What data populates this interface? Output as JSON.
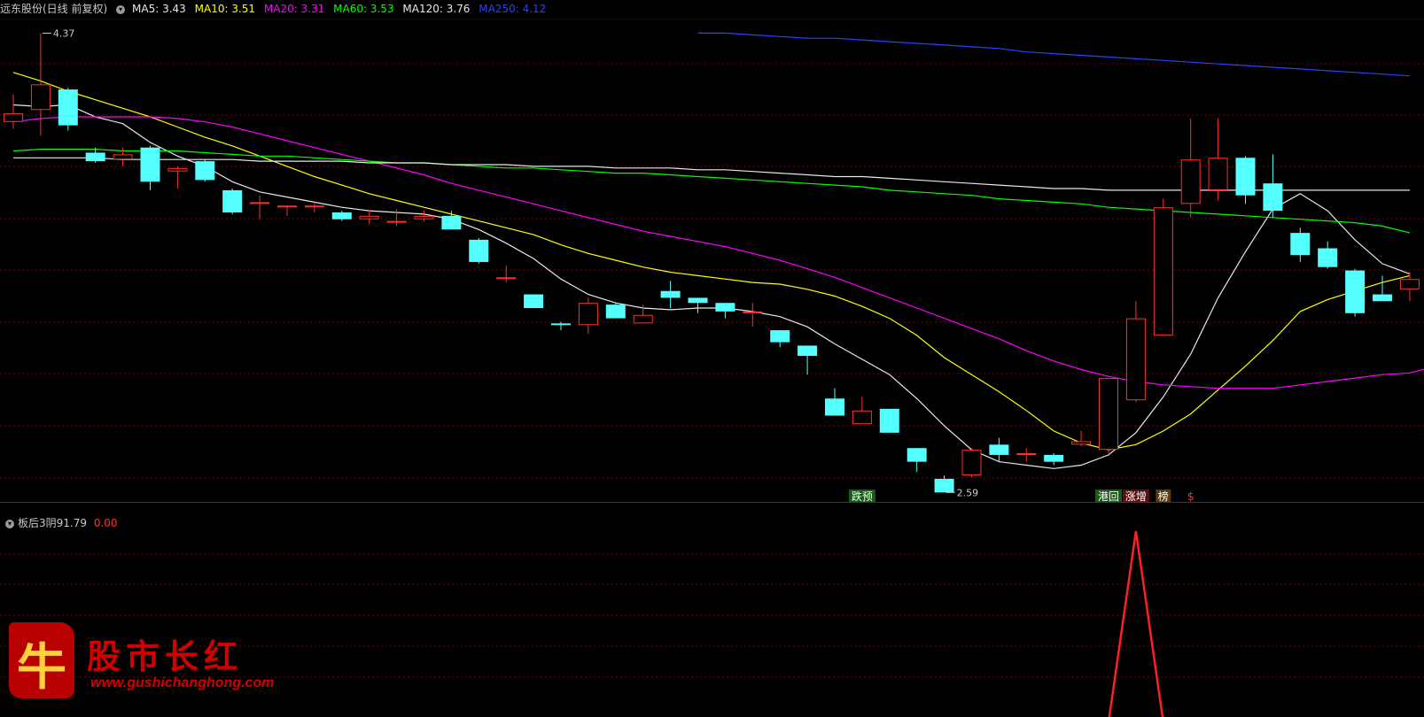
{
  "header": {
    "stock": "远东股份(日线 前复权)",
    "ma": [
      {
        "label": "MA5: 3.43",
        "color": "#e8e8e8"
      },
      {
        "label": "MA10: 3.51",
        "color": "#ffff00"
      },
      {
        "label": "MA20: 3.31",
        "color": "#ff00ff"
      },
      {
        "label": "MA60: 3.53",
        "color": "#00ff00"
      },
      {
        "label": "MA120: 3.76",
        "color": "#e8e8e8"
      },
      {
        "label": "MA250: 4.12",
        "color": "#2a40ff"
      }
    ]
  },
  "indicator": {
    "name": "板后3阴91.79",
    "value": "0.00"
  },
  "logo": {
    "icon_char": "牛",
    "brand": "股市长红",
    "url": "www.gushichanghong.com"
  },
  "colors": {
    "up": "#ff3030",
    "down": "#54ffff",
    "grid": "#7a0000"
  },
  "chart_data": {
    "type": "candlestick",
    "candles": [
      [
        3.85,
        3.9,
        4.01,
        3.81
      ],
      [
        3.92,
        4.07,
        4.37,
        3.77
      ],
      [
        4.04,
        3.83,
        4.05,
        3.8
      ],
      [
        3.67,
        3.62,
        3.7,
        3.61
      ],
      [
        3.63,
        3.66,
        3.7,
        3.59
      ],
      [
        3.7,
        3.5,
        3.71,
        3.45
      ],
      [
        3.56,
        3.58,
        3.59,
        3.46
      ],
      [
        3.62,
        3.51,
        3.63,
        3.5
      ],
      [
        3.45,
        3.32,
        3.46,
        3.31
      ],
      [
        3.38,
        3.38,
        3.42,
        3.28
      ],
      [
        3.35,
        3.36,
        3.36,
        3.3
      ],
      [
        3.36,
        3.36,
        3.38,
        3.32
      ],
      [
        3.32,
        3.28,
        3.33,
        3.27
      ],
      [
        3.28,
        3.3,
        3.33,
        3.25
      ],
      [
        3.27,
        3.27,
        3.34,
        3.24
      ],
      [
        3.28,
        3.3,
        3.33,
        3.27
      ],
      [
        3.3,
        3.22,
        3.33,
        3.22
      ],
      [
        3.16,
        3.03,
        3.17,
        3.02
      ],
      [
        2.94,
        2.94,
        3.01,
        2.91
      ],
      [
        2.84,
        2.76,
        2.84,
        2.76
      ],
      [
        2.67,
        2.66,
        2.68,
        2.63
      ],
      [
        2.66,
        2.79,
        2.82,
        2.61
      ],
      [
        2.78,
        2.7,
        2.79,
        2.7
      ],
      [
        2.67,
        2.72,
        2.78,
        2.67
      ],
      [
        2.86,
        2.82,
        2.92,
        2.76
      ],
      [
        2.82,
        2.79,
        2.82,
        2.73
      ],
      [
        2.79,
        2.74,
        2.76,
        2.7
      ],
      [
        2.73,
        2.74,
        2.79,
        2.65
      ],
      [
        2.63,
        2.56,
        2.63,
        2.53
      ],
      [
        2.54,
        2.48,
        2.54,
        2.37
      ],
      [
        2.23,
        2.13,
        2.29,
        2.13
      ],
      [
        2.08,
        2.16,
        2.24,
        2.08
      ],
      [
        2.17,
        2.03,
        2.17,
        2.03
      ],
      [
        1.94,
        1.86,
        1.94,
        1.8
      ],
      [
        1.76,
        1.68,
        1.78,
        1.68
      ],
      [
        1.78,
        1.93,
        1.94,
        1.77
      ],
      [
        1.96,
        1.9,
        2.0,
        1.86
      ],
      [
        1.9,
        1.91,
        1.94,
        1.86
      ],
      [
        1.9,
        1.86,
        1.91,
        1.84
      ],
      [
        1.96,
        1.98,
        2.04,
        1.95
      ],
      [
        1.93,
        2.35,
        2.35,
        1.91
      ],
      [
        2.22,
        2.7,
        2.8,
        2.21
      ],
      [
        2.6,
        3.35,
        3.4,
        2.6
      ],
      [
        3.37,
        3.63,
        3.87,
        3.29
      ],
      [
        3.45,
        3.64,
        3.87,
        3.39
      ],
      [
        3.64,
        3.42,
        3.65,
        3.37
      ],
      [
        3.49,
        3.33,
        3.66,
        3.29
      ],
      [
        3.2,
        3.07,
        3.23,
        3.03
      ],
      [
        3.11,
        3.0,
        3.15,
        2.99
      ],
      [
        2.98,
        2.73,
        2.99,
        2.71
      ],
      [
        2.84,
        2.8,
        2.95,
        2.8
      ],
      [
        2.87,
        2.93,
        2.97,
        2.8
      ]
    ],
    "ma_series": [
      {
        "name": "MA5",
        "color": "#e8e8e8",
        "values": [
          3.95,
          3.94,
          3.95,
          3.88,
          3.84,
          3.73,
          3.65,
          3.59,
          3.5,
          3.44,
          3.41,
          3.38,
          3.35,
          3.33,
          3.32,
          3.31,
          3.28,
          3.22,
          3.14,
          3.05,
          2.93,
          2.84,
          2.79,
          2.76,
          2.75,
          2.76,
          2.76,
          2.74,
          2.71,
          2.65,
          2.55,
          2.46,
          2.37,
          2.23,
          2.07,
          1.93,
          1.86,
          1.84,
          1.82,
          1.84,
          1.9,
          2.03,
          2.24,
          2.49,
          2.82,
          3.09,
          3.34,
          3.43,
          3.33,
          3.16,
          3.02,
          2.96
        ]
      },
      {
        "name": "MA10",
        "color": "#ffff00",
        "values": [
          4.14,
          4.09,
          4.03,
          3.98,
          3.93,
          3.88,
          3.82,
          3.76,
          3.71,
          3.65,
          3.59,
          3.53,
          3.48,
          3.43,
          3.39,
          3.35,
          3.31,
          3.27,
          3.23,
          3.19,
          3.13,
          3.08,
          3.04,
          3.0,
          2.97,
          2.95,
          2.93,
          2.91,
          2.9,
          2.87,
          2.83,
          2.77,
          2.7,
          2.6,
          2.47,
          2.37,
          2.27,
          2.16,
          2.04,
          1.97,
          1.93,
          1.96,
          2.04,
          2.14,
          2.28,
          2.42,
          2.57,
          2.74,
          2.81,
          2.86,
          2.91,
          2.95
        ]
      },
      {
        "name": "MA20",
        "color": "#ff00ff",
        "values": [
          3.85,
          3.87,
          3.88,
          3.88,
          3.88,
          3.88,
          3.87,
          3.85,
          3.82,
          3.78,
          3.74,
          3.7,
          3.66,
          3.62,
          3.58,
          3.54,
          3.49,
          3.45,
          3.41,
          3.37,
          3.33,
          3.29,
          3.25,
          3.21,
          3.18,
          3.15,
          3.12,
          3.08,
          3.04,
          2.99,
          2.94,
          2.88,
          2.82,
          2.76,
          2.7,
          2.64,
          2.58,
          2.51,
          2.45,
          2.4,
          2.36,
          2.33,
          2.31,
          2.3,
          2.29,
          2.29,
          2.29,
          2.31,
          2.33,
          2.35,
          2.37,
          2.38,
          2.42
        ]
      },
      {
        "name": "MA60",
        "color": "#00ff00",
        "values": [
          3.68,
          3.69,
          3.69,
          3.69,
          3.68,
          3.68,
          3.68,
          3.67,
          3.66,
          3.65,
          3.65,
          3.64,
          3.63,
          3.62,
          3.61,
          3.61,
          3.6,
          3.59,
          3.58,
          3.58,
          3.57,
          3.56,
          3.55,
          3.55,
          3.54,
          3.53,
          3.52,
          3.51,
          3.5,
          3.49,
          3.48,
          3.47,
          3.45,
          3.44,
          3.43,
          3.42,
          3.4,
          3.39,
          3.38,
          3.37,
          3.35,
          3.34,
          3.33,
          3.32,
          3.31,
          3.3,
          3.29,
          3.28,
          3.27,
          3.26,
          3.24,
          3.2
        ]
      },
      {
        "name": "MA120",
        "color": "#e8e8e8",
        "values": [
          3.64,
          3.64,
          3.64,
          3.64,
          3.63,
          3.63,
          3.63,
          3.63,
          3.63,
          3.62,
          3.62,
          3.62,
          3.62,
          3.61,
          3.61,
          3.61,
          3.6,
          3.6,
          3.6,
          3.59,
          3.59,
          3.59,
          3.58,
          3.58,
          3.58,
          3.57,
          3.57,
          3.56,
          3.55,
          3.54,
          3.53,
          3.53,
          3.52,
          3.51,
          3.5,
          3.49,
          3.48,
          3.47,
          3.46,
          3.46,
          3.45,
          3.45,
          3.45,
          3.45,
          3.45,
          3.45,
          3.45,
          3.45,
          3.45,
          3.45,
          3.45,
          3.45
        ]
      },
      {
        "name": "MA250",
        "color": "#2a40ff",
        "values": [
          null,
          null,
          null,
          null,
          null,
          null,
          null,
          null,
          null,
          null,
          null,
          null,
          null,
          null,
          null,
          null,
          null,
          null,
          null,
          null,
          null,
          null,
          null,
          null,
          null,
          4.37,
          4.37,
          4.36,
          4.35,
          4.34,
          4.34,
          4.33,
          4.32,
          4.31,
          4.3,
          4.29,
          4.28,
          4.26,
          4.25,
          4.24,
          4.23,
          4.22,
          4.21,
          4.2,
          4.19,
          4.18,
          4.17,
          4.16,
          4.15,
          4.14,
          4.13,
          4.12
        ]
      }
    ],
    "labels": [
      {
        "candle": 1,
        "text": "4.37",
        "at": "high"
      },
      {
        "candle": 34,
        "text": "2.59",
        "at": "low"
      }
    ],
    "signals": [
      {
        "candle": 31,
        "text": "跌预",
        "bg": "#1c5a1c",
        "color": "#e8ffe8"
      },
      {
        "candle": 40,
        "text": "港回",
        "bg": "#1c5a1c",
        "color": "#ffffff"
      },
      {
        "candle": 41,
        "text": "涨增",
        "bg": "#5a1010",
        "color": "#ffffff"
      },
      {
        "candle": 42,
        "text": "榜",
        "bg": "#5a3a10",
        "color": "#ffffff"
      },
      {
        "candle": 43,
        "text": "$",
        "bg": "",
        "color": "#ff3030"
      }
    ],
    "sub_indicator": {
      "name": "板后3阴",
      "values": [
        0,
        0,
        0,
        0,
        0,
        0,
        0,
        0,
        0,
        0,
        0,
        0,
        0,
        0,
        0,
        0,
        0,
        0,
        0,
        0,
        0,
        0,
        0,
        0,
        0,
        0,
        0,
        0,
        0,
        0,
        0,
        0,
        0,
        0,
        0,
        0,
        0,
        0,
        0,
        0,
        0,
        1,
        0,
        0,
        0,
        0,
        0,
        0,
        0,
        0,
        0,
        0
      ],
      "color": "#ff2020"
    },
    "price_range": [
      1.63,
      4.45
    ]
  }
}
